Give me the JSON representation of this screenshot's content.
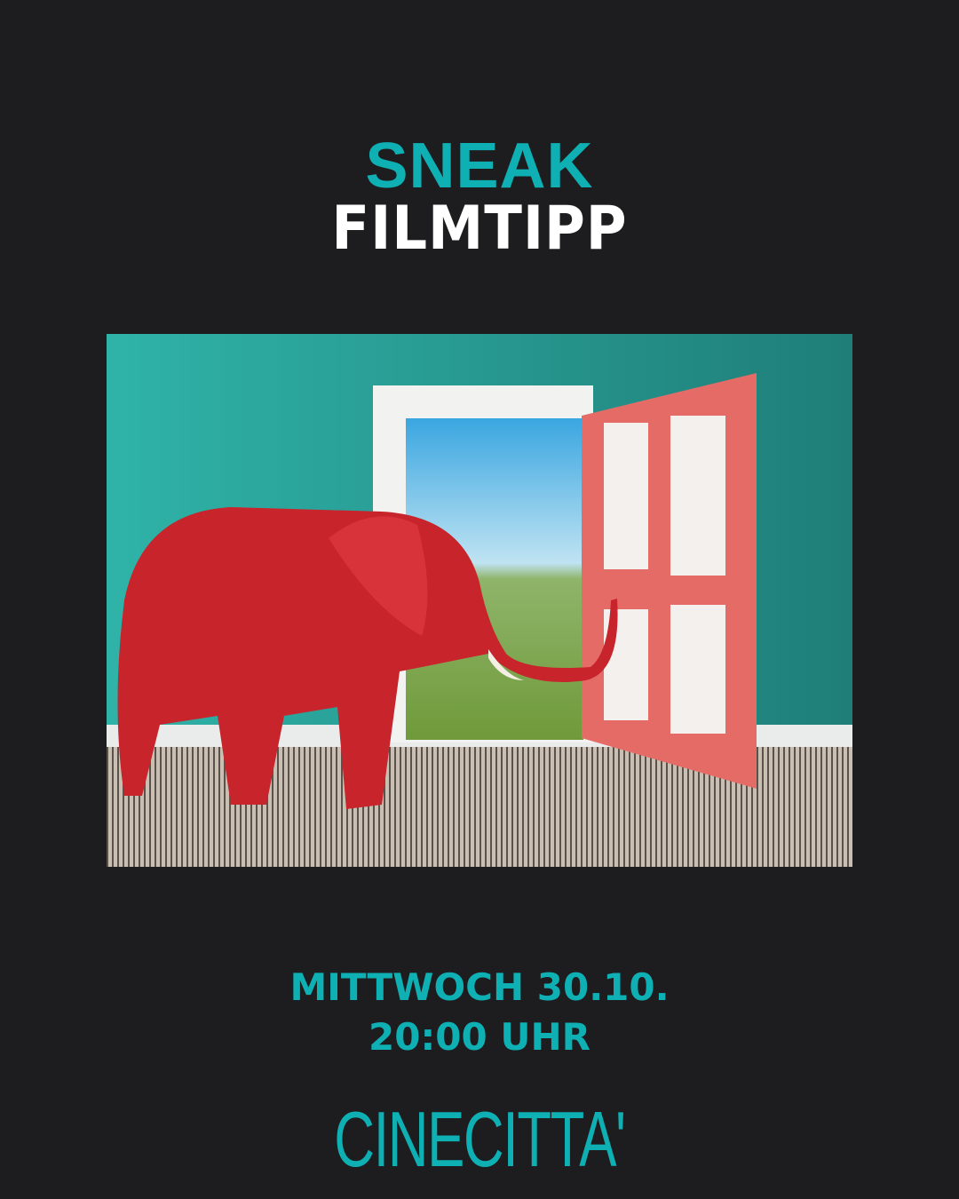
{
  "header": {
    "title_top": "SNEAK",
    "title_bottom": "FILMTIPP"
  },
  "event": {
    "day_date": "MITTWOCH 30.10.",
    "time": "20:00 UHR"
  },
  "brand": {
    "logo": "CINECITTA'"
  },
  "colors": {
    "accent": "#0fb0b3",
    "background": "#1d1d1f"
  }
}
